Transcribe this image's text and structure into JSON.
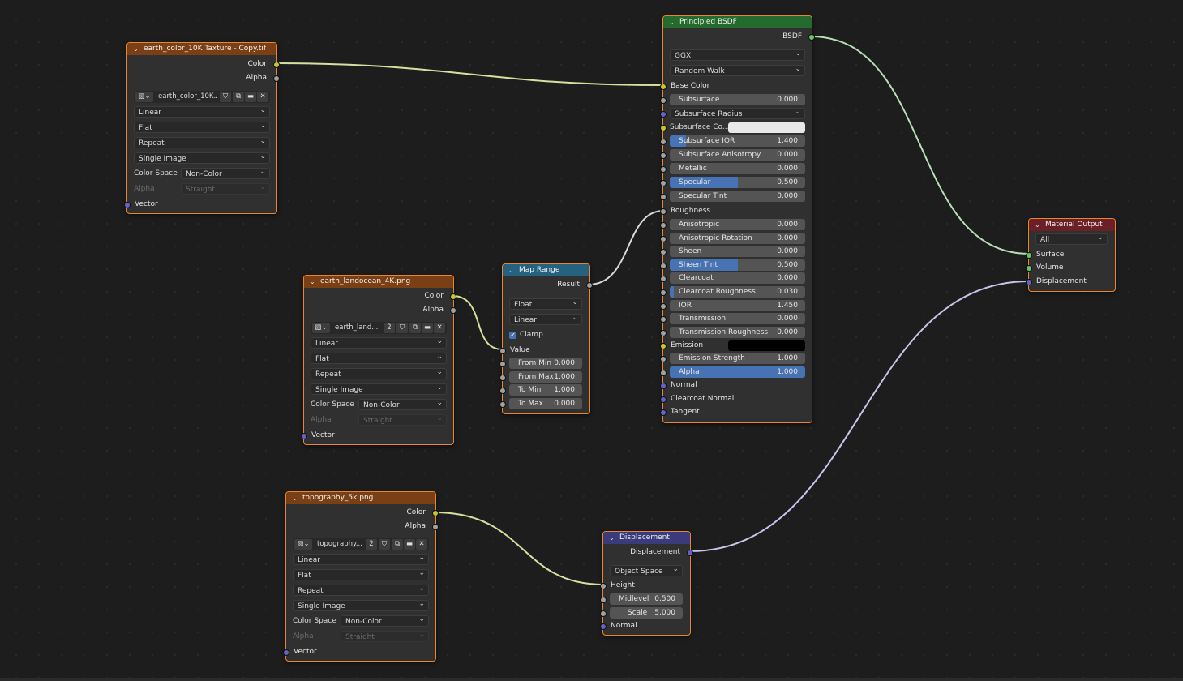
{
  "nodes": {
    "tex1": {
      "title": "earth_color_10K Taxture - Copy.tif",
      "outputs": [
        "Color",
        "Alpha"
      ],
      "image_name": "earth_color_10K...",
      "interpolation": "Linear",
      "projection": "Flat",
      "extension": "Repeat",
      "source": "Single Image",
      "color_space_label": "Color Space",
      "color_space": "Non-Color",
      "alpha_label": "Alpha",
      "alpha_mode": "Straight",
      "input_vector": "Vector"
    },
    "tex2": {
      "title": "earth_landocean_4K.png",
      "outputs": [
        "Color",
        "Alpha"
      ],
      "image_name": "earth_land...",
      "user_count": "2",
      "interpolation": "Linear",
      "projection": "Flat",
      "extension": "Repeat",
      "source": "Single Image",
      "color_space_label": "Color Space",
      "color_space": "Non-Color",
      "alpha_label": "Alpha",
      "alpha_mode": "Straight",
      "input_vector": "Vector"
    },
    "tex3": {
      "title": "topography_5k.png",
      "outputs": [
        "Color",
        "Alpha"
      ],
      "image_name": "topography...",
      "user_count": "2",
      "interpolation": "Linear",
      "projection": "Flat",
      "extension": "Repeat",
      "source": "Single Image",
      "color_space_label": "Color Space",
      "color_space": "Non-Color",
      "alpha_label": "Alpha",
      "alpha_mode": "Straight",
      "input_vector": "Vector"
    },
    "map_range": {
      "title": "Map Range",
      "output": "Result",
      "data_type": "Float",
      "interpolation": "Linear",
      "clamp_label": "Clamp",
      "clamp": true,
      "input_value": "Value",
      "fields": [
        {
          "label": "From Min",
          "value": "0.000"
        },
        {
          "label": "From Max",
          "value": "1.000"
        },
        {
          "label": "To Min",
          "value": "1.000"
        },
        {
          "label": "To Max",
          "value": "0.000"
        }
      ]
    },
    "bsdf": {
      "title": "Principled BSDF",
      "output": "BSDF",
      "distribution": "GGX",
      "subsurface_method": "Random Walk",
      "base_color": "Base Color",
      "subsurface": {
        "label": "Subsurface",
        "value": "0.000"
      },
      "subsurface_radius": "Subsurface Radius",
      "subsurface_color": "Subsurface Co...",
      "sliders": [
        {
          "label": "Subsurface IOR",
          "value": "1.400",
          "fill": 0.12
        },
        {
          "label": "Subsurface Anisotropy",
          "value": "0.000",
          "fill": 0
        },
        {
          "label": "Metallic",
          "value": "0.000",
          "fill": 0
        },
        {
          "label": "Specular",
          "value": "0.500",
          "fill": 0.5
        },
        {
          "label": "Specular Tint",
          "value": "0.000",
          "fill": 0
        }
      ],
      "roughness": "Roughness",
      "sliders2": [
        {
          "label": "Anisotropic",
          "value": "0.000",
          "fill": 0
        },
        {
          "label": "Anisotropic Rotation",
          "value": "0.000",
          "fill": 0
        },
        {
          "label": "Sheen",
          "value": "0.000",
          "fill": 0
        },
        {
          "label": "Sheen Tint",
          "value": "0.500",
          "fill": 0.5
        },
        {
          "label": "Clearcoat",
          "value": "0.000",
          "fill": 0
        },
        {
          "label": "Clearcoat Roughness",
          "value": "0.030",
          "fill": 0.03
        },
        {
          "label": "IOR",
          "value": "1.450",
          "fill": 0
        },
        {
          "label": "Transmission",
          "value": "0.000",
          "fill": 0
        },
        {
          "label": "Transmission Roughness",
          "value": "0.000",
          "fill": 0
        }
      ],
      "emission": "Emission",
      "emission_strength": {
        "label": "Emission Strength",
        "value": "1.000"
      },
      "alpha": {
        "label": "Alpha",
        "value": "1.000",
        "fill": 1
      },
      "normal": "Normal",
      "clearcoat_normal": "Clearcoat Normal",
      "tangent": "Tangent"
    },
    "material_output": {
      "title": "Material Output",
      "target": "All",
      "inputs": [
        "Surface",
        "Volume",
        "Displacement"
      ]
    },
    "displacement": {
      "title": "Displacement",
      "output": "Displacement",
      "space": "Object Space",
      "height": "Height",
      "midlevel": {
        "label": "Midlevel",
        "value": "0.500"
      },
      "scale": {
        "label": "Scale",
        "value": "5.000"
      },
      "normal": "Normal"
    }
  },
  "colors": {
    "socket_color": "#c7c729",
    "socket_float": "#a1a1a1",
    "socket_vector": "#6363c7",
    "socket_shader": "#63c763",
    "slider_fill": "#4772b3",
    "header_texture": "#7a3f14",
    "header_shader": "#256b2e",
    "header_converter": "#24627f",
    "header_vector": "#3b3a7a",
    "header_output": "#6b1f26"
  }
}
